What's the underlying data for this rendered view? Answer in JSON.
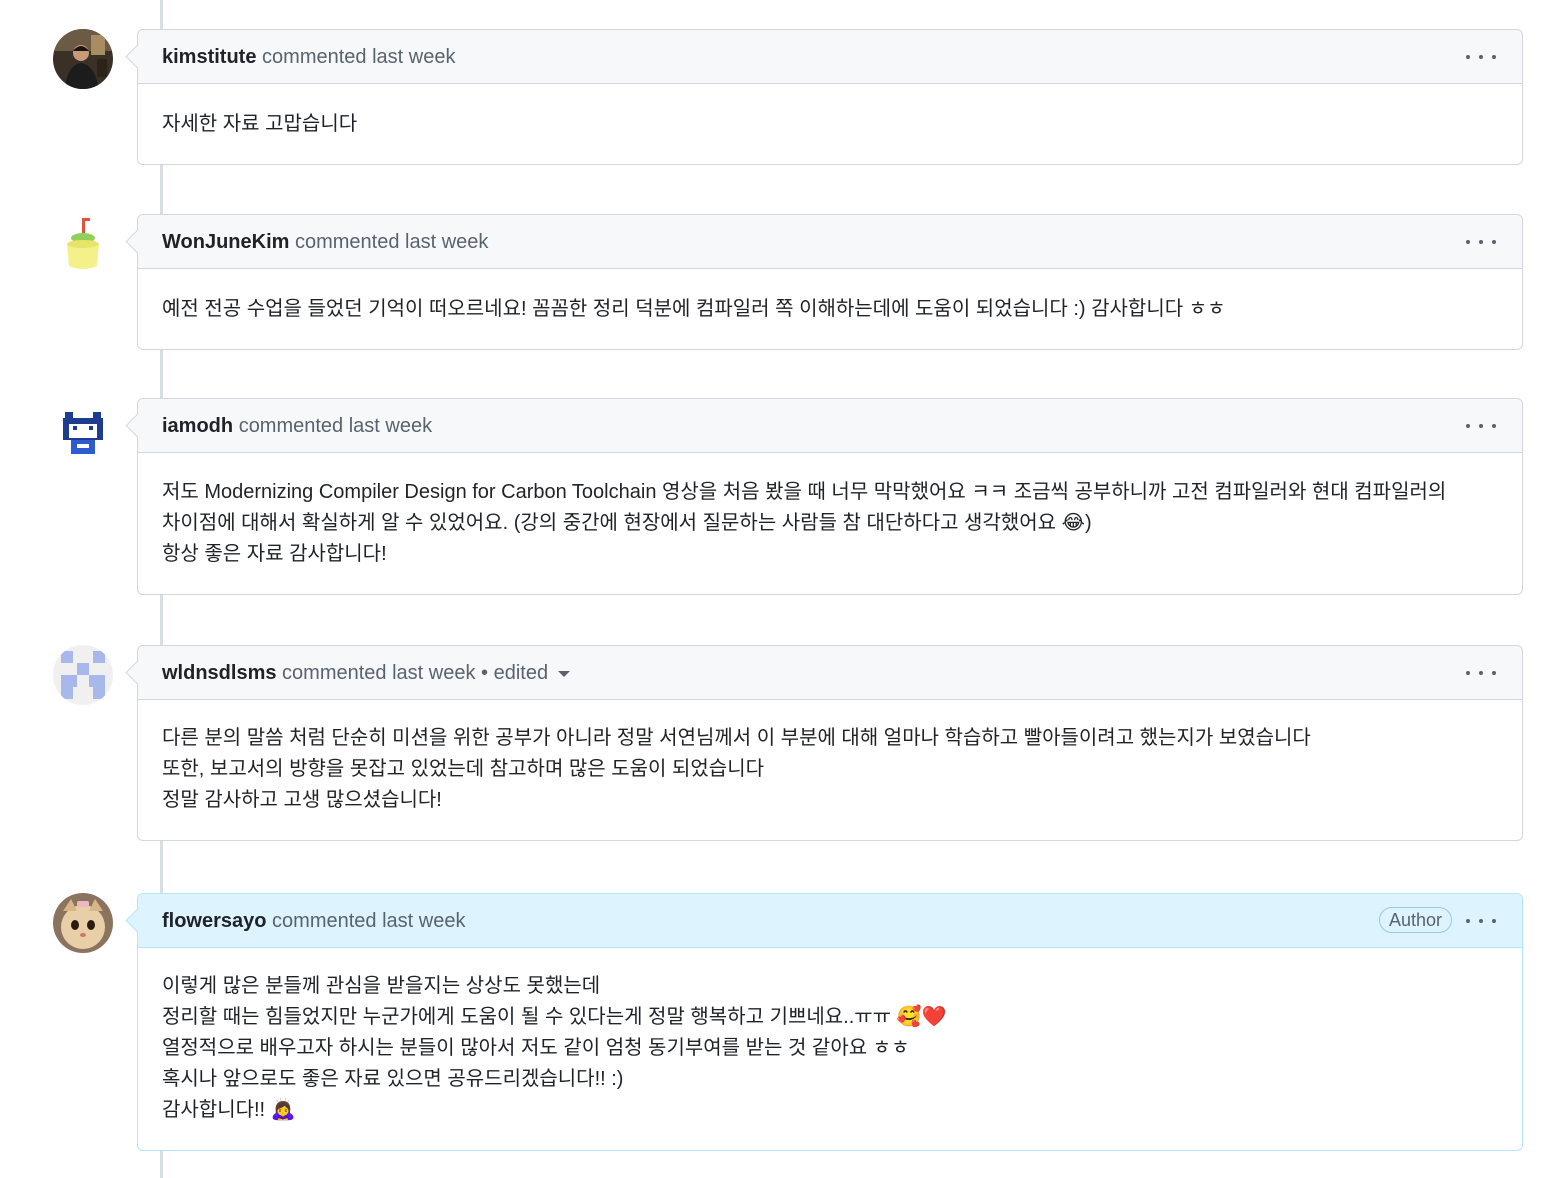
{
  "comments": [
    {
      "author": "kimstitute",
      "meta": "commented last week",
      "edited": "",
      "badge": "",
      "avatar_icon": "photo-avatar-person",
      "lines": [
        "자세한 자료 고맙습니다"
      ]
    },
    {
      "author": "WonJuneKim",
      "meta": "commented last week",
      "edited": "",
      "badge": "",
      "avatar_icon": "melon-drink-avatar",
      "lines": [
        "예전 전공 수업을 들었던 기억이 떠오르네요! 꼼꼼한 정리 덕분에 컴파일러 쪽 이해하는데에 도움이 되었습니다 :) 감사합니다 ㅎㅎ"
      ]
    },
    {
      "author": "iamodh",
      "meta": "commented last week",
      "edited": "",
      "badge": "",
      "avatar_icon": "pixel-cat-avatar",
      "lines": [
        "저도 Modernizing Compiler Design for Carbon Toolchain 영상을 처음 봤을 때 너무 막막했어요 ㅋㅋ 조금씩 공부하니까 고전 컴파일러와 현대 컴파일러의",
        "차이점에 대해서 확실하게 알 수 있었어요. (강의 중간에 현장에서 질문하는 사람들 참 대단하다고 생각했어요 😂)",
        "항상 좋은 자료 감사합니다!"
      ]
    },
    {
      "author": "wldnsdlsms",
      "meta": "commented last week",
      "edited": "• edited",
      "badge": "",
      "avatar_icon": "identicon-avatar",
      "lines": [
        "다른 분의 말씀 처럼 단순히 미션을 위한 공부가 아니라 정말 서연님께서 이 부분에 대해 얼마나 학습하고 빨아들이려고 했는지가 보였습니다",
        "또한, 보고서의 방향을 못잡고 있었는데 참고하며 많은 도움이 되었습니다",
        "정말 감사하고 고생 많으셨습니다!"
      ]
    },
    {
      "author": "flowersayo",
      "meta": "commented last week",
      "edited": "",
      "badge": "Author",
      "avatar_icon": "cat-photo-avatar",
      "lines": [
        "이렇게 많은 분들께 관심을 받을지는 상상도 못했는데",
        "정리할 때는 힘들었지만 누군가에게 도움이 될 수 있다는게 정말 행복하고 기쁘네요..ㅠㅠ 🥰❤️",
        "열정적으로 배우고자 하시는 분들이 많아서 저도 같이 엄청 동기부여를 받는 것 같아요 ㅎㅎ",
        "혹시나 앞으로도 좋은 자료 있으면 공유드리겠습니다!! :)",
        "감사합니다!! 🙇‍♀️"
      ]
    }
  ],
  "colors": {
    "border": "#d0d7de",
    "header_bg": "#f6f8fa",
    "author_header_bg": "#ddf4ff",
    "meta_text": "#59636e"
  }
}
